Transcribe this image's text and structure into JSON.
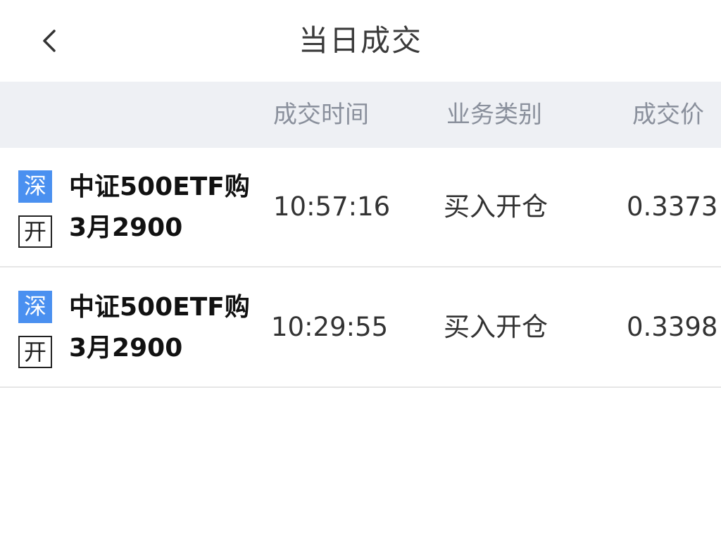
{
  "header": {
    "title": "当日成交",
    "back_icon": "chevron-left-icon"
  },
  "columns": {
    "time": "成交时间",
    "type": "业务类别",
    "price": "成交价"
  },
  "rows": [
    {
      "exchange_badge": "深",
      "open_badge": "开",
      "name_line1": "中证500ETF购",
      "name_line2": "3月2900",
      "time": "10:57:16",
      "type": "买入开仓",
      "price": "0.3373"
    },
    {
      "exchange_badge": "深",
      "open_badge": "开",
      "name_line1": "中证500ETF购",
      "name_line2": "3月2900",
      "time": "10:29:55",
      "type": "买入开仓",
      "price": "0.3398"
    }
  ],
  "colors": {
    "accent": "#4a90f0",
    "header_bg": "#eef0f4",
    "muted_text": "#8a909c"
  }
}
